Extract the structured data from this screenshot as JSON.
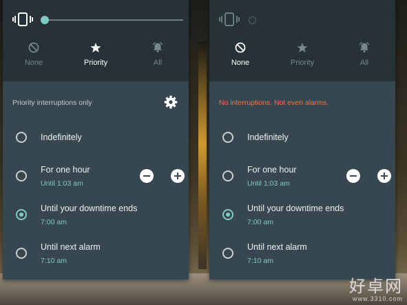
{
  "left": {
    "modes": [
      {
        "label": "None",
        "icon": "no-interruptions-icon",
        "active": false
      },
      {
        "label": "Priority",
        "icon": "star-icon",
        "active": true
      },
      {
        "label": "All",
        "icon": "bell-icon",
        "active": false
      }
    ],
    "header": "Priority interruptions only",
    "options": [
      {
        "title": "Indefinitely",
        "sub": ""
      },
      {
        "title": "For one hour",
        "sub": "Until 1:03 am"
      },
      {
        "title": "Until your downtime ends",
        "sub": "7:00 am"
      },
      {
        "title": "Until next alarm",
        "sub": "7:10 am"
      }
    ],
    "selected_option": 2
  },
  "right": {
    "modes": [
      {
        "label": "None",
        "icon": "no-interruptions-icon",
        "active": true
      },
      {
        "label": "Priority",
        "icon": "star-icon",
        "active": false
      },
      {
        "label": "All",
        "icon": "bell-icon",
        "active": false
      }
    ],
    "header": "No interruptions. Not even alarms.",
    "options": [
      {
        "title": "Indefinitely",
        "sub": ""
      },
      {
        "title": "For one hour",
        "sub": "Until 1:03 am"
      },
      {
        "title": "Until your downtime ends",
        "sub": "7:00 am"
      },
      {
        "title": "Until next alarm",
        "sub": "7:10 am"
      }
    ],
    "selected_option": 2
  },
  "watermark": {
    "big": "好卓网",
    "small": "www.3310.com"
  },
  "colors": {
    "accent": "#7fcbc4",
    "warning": "#ff6e40",
    "panel": "#37474f",
    "panel_top": "#263238"
  }
}
